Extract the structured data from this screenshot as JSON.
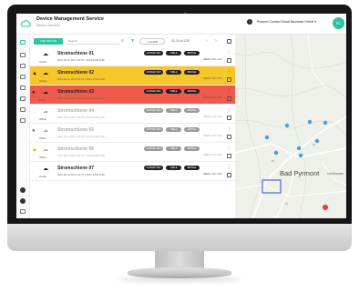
{
  "app": {
    "title": "Device Management Service",
    "subtitle": "Device overview",
    "company": "Phoenix Contact Smart Business GmbH",
    "help_icon": "help-icon",
    "avatar_initials": "PC",
    "accent": "#2ec4a3"
  },
  "toolbar": {
    "add_label": "ADD DEVICE",
    "search_placeholder": "Search",
    "filter_label": "+ FILTER",
    "pager": "01-10 of 120",
    "prev": "‹",
    "next": "›"
  },
  "rows": [
    {
      "title": "Stromschiene 01",
      "status": "Online",
      "sub": "MAC:00:1e:b8:cc:30:70 | 2014-3100-1190",
      "tags": [
        "CONNECTED",
        "TABLE",
        "BRIDGE"
      ],
      "meta": "SERIAL NO. 1011",
      "state": "normal",
      "warn": ""
    },
    {
      "title": "Stromschiene 02",
      "status": "Online",
      "sub": "MAC:00:1e:b8:cc:30:70 | 2014-3100-1190",
      "tags": [
        "CONNECTED",
        "TABLE",
        "BRIDGE"
      ],
      "meta": "SERIAL NO. 1011",
      "state": "warning",
      "warn": "▲"
    },
    {
      "title": "Stromschiene 03",
      "status": "Error",
      "sub": "MAC:00:1e:b8:cc:30:70 | 2014-3100-1190",
      "tags": [
        "CONNECTED",
        "TABLE",
        "BRIDGE"
      ],
      "meta": "SERIAL NO. 1011",
      "state": "error",
      "warn": "●"
    },
    {
      "title": "Stromschiene 04",
      "status": "Offline",
      "sub": "MAC:00:1e:b8:cc:30:70 | 2014-3100-1190",
      "tags": [
        "CONNECTED",
        "TABLE",
        "BRIDGE"
      ],
      "meta": "SERIAL NO. 1011",
      "state": "offline",
      "warn": ""
    },
    {
      "title": "Stromschiene 05",
      "status": "Offline",
      "sub": "MAC:00:1e:b8:cc:30:70 | 2014-3100-1190",
      "tags": [
        "CONNECTED",
        "TABLE",
        "BRIDGE"
      ],
      "meta": "SERIAL NO. 1011",
      "state": "offline",
      "warn": "●"
    },
    {
      "title": "Stromschiene 06",
      "status": "Offline",
      "sub": "MAC:00:1e:b8:cc:30:70 | 2014-3100-1190",
      "tags": [
        "CONNECTED",
        "TABLE",
        "BRIDGE"
      ],
      "meta": "SERIAL NO. 1011",
      "state": "offline",
      "warn": "▲"
    },
    {
      "title": "Stromschiene 07",
      "status": "Online",
      "sub": "MAC:00:1e:b8:cc:30:70 | 2014-3100-1190",
      "tags": [
        "CONNECTED",
        "TABLE",
        "BRIDGE"
      ],
      "meta": "SERIAL NO. 1011",
      "state": "normal",
      "warn": ""
    }
  ],
  "map": {
    "city": "Bad Pyrmont",
    "town": "Holzhausen"
  },
  "colors": {
    "warning_row": "#f7c629",
    "error_row": "#ee5a4c",
    "error_dot": "#e53935",
    "warning_icon": "#f0a400"
  }
}
